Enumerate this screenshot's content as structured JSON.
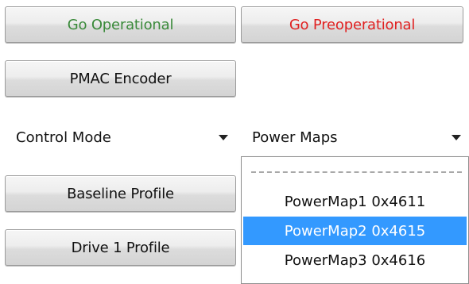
{
  "buttons": {
    "go_operational": {
      "label": "Go Operational",
      "color": "#3a8a3a"
    },
    "go_preoperational": {
      "label": "Go Preoperational",
      "color": "#e02020"
    },
    "pmac_encoder": {
      "label": "PMAC Encoder"
    },
    "baseline_profile": {
      "label": "Baseline Profile"
    },
    "drive1_profile": {
      "label": "Drive 1 Profile"
    }
  },
  "control_mode": {
    "value": "Control Mode",
    "icon": "chevron-down-icon"
  },
  "power_maps": {
    "value": "Power Maps",
    "icon": "chevron-down-icon",
    "options": [
      {
        "label": "PowerMap1 0x4611",
        "selected": false
      },
      {
        "label": "PowerMap2 0x4615",
        "selected": true
      },
      {
        "label": "PowerMap3 0x4616",
        "selected": false
      }
    ],
    "highlight_color": "#3399ff"
  }
}
